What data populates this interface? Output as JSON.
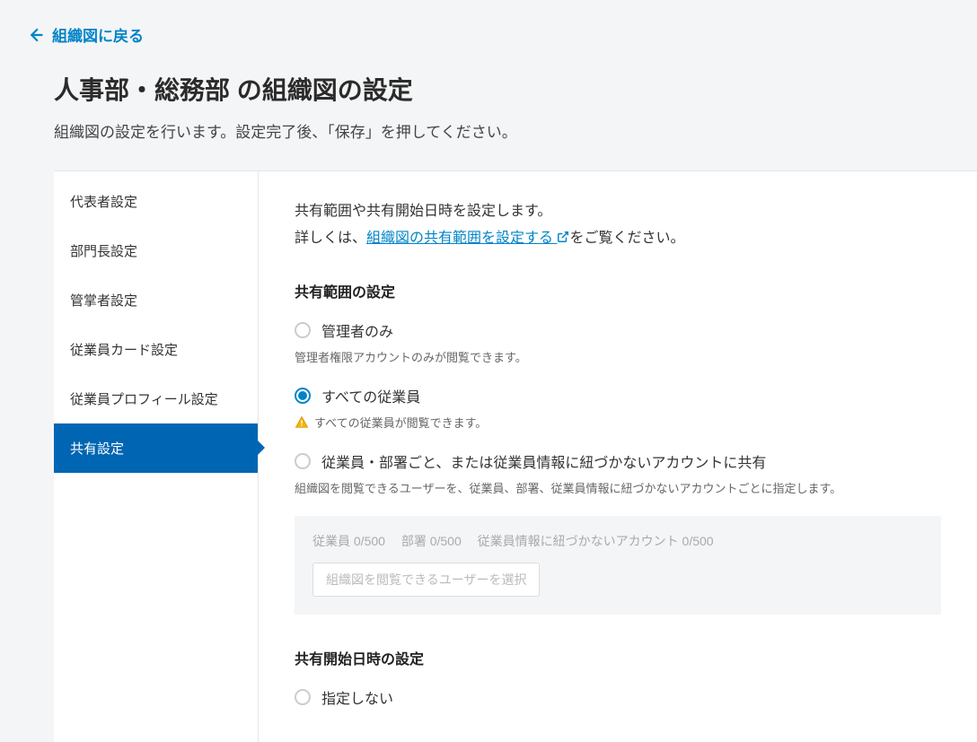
{
  "back_link": "組織図に戻る",
  "page_title": "人事部・総務部 の組織図の設定",
  "page_subtitle": "組織図の設定を行います。設定完了後、「保存」を押してください。",
  "sidebar": {
    "items": [
      {
        "label": "代表者設定"
      },
      {
        "label": "部門長設定"
      },
      {
        "label": "管掌者設定"
      },
      {
        "label": "従業員カード設定"
      },
      {
        "label": "従業員プロフィール設定"
      },
      {
        "label": "共有設定"
      }
    ]
  },
  "main": {
    "intro_line1": "共有範囲や共有開始日時を設定します。",
    "intro_line2_prefix": "詳しくは、",
    "intro_link": "組織図の共有範囲を設定する",
    "intro_line2_suffix": "をご覧ください。",
    "scope_section_title": "共有範囲の設定",
    "radio1_label": "管理者のみ",
    "radio1_desc": "管理者権限アカウントのみが閲覧できます。",
    "radio2_label": "すべての従業員",
    "radio2_desc": "すべての従業員が閲覧できます。",
    "radio3_label": "従業員・部署ごと、または従業員情報に紐づかないアカウントに共有",
    "radio3_desc": "組織図を閲覧できるユーザーを、従業員、部署、従業員情報に紐づかないアカウントごとに指定します。",
    "count_employee": "従業員 0/500",
    "count_dept": "部署 0/500",
    "count_account": "従業員情報に紐づかないアカウント 0/500",
    "select_btn": "組織図を閲覧できるユーザーを選択",
    "datetime_section_title": "共有開始日時の設定",
    "datetime_radio1_label": "指定しない"
  }
}
